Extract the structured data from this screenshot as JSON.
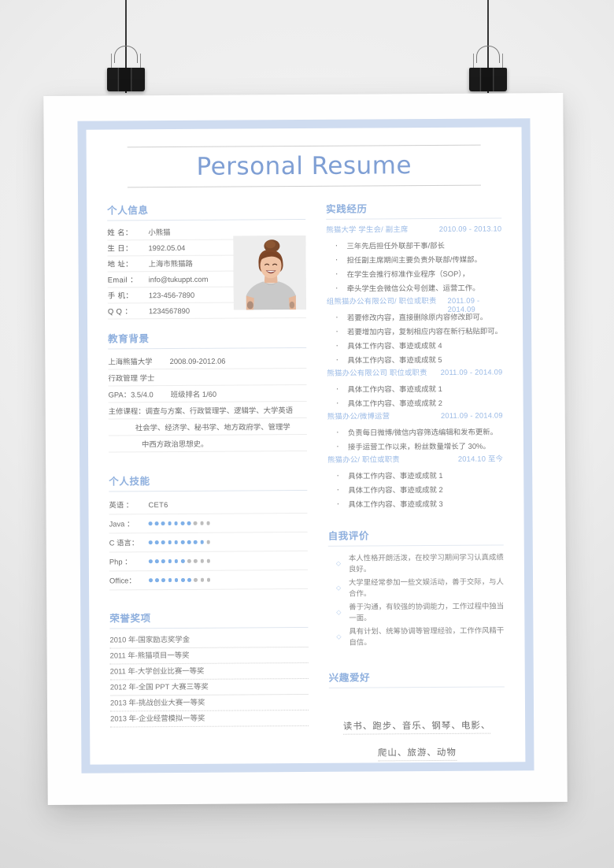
{
  "document": {
    "title": "Personal Resume"
  },
  "left": {
    "personal_info": {
      "heading": "个人信息",
      "rows": [
        {
          "key": "姓  名：",
          "value": "小熊猫"
        },
        {
          "key": "生  日：",
          "value": "1992.05.04"
        },
        {
          "key": "地  址：",
          "value": "上海市熊猫路"
        },
        {
          "key": "Email ：",
          "value": "info@tukuppt.com"
        },
        {
          "key": "手  机：",
          "value": "123-456-7890"
        },
        {
          "key": "Q  Q ：",
          "value": "1234567890"
        }
      ],
      "photo_alt": "portrait-photo"
    },
    "education": {
      "heading": "教育背景",
      "rows": [
        {
          "text": "上海熊猫大学",
          "extra": "2008.09-2012.06",
          "indent": 0
        },
        {
          "text": "行政管理 学士",
          "extra": "",
          "indent": 0
        },
        {
          "text": "GPA：3.5/4.0",
          "extra": "班级排名 1/60",
          "indent": 0
        },
        {
          "text": "主修课程：调查与方案、行政管理学、逻辑学、大学英语",
          "extra": "",
          "indent": 0
        },
        {
          "text": "社会学、经济学、秘书学、地方政府学、管理学",
          "extra": "",
          "indent": 1
        },
        {
          "text": "中西方政治思想史。",
          "extra": "",
          "indent": 2
        }
      ]
    },
    "skills": {
      "heading": "个人技能",
      "rows": [
        {
          "key": "英语  ：",
          "value": "CET6",
          "filled": null,
          "total": null
        },
        {
          "key": "Java  ：",
          "value": "",
          "filled": 7,
          "total": 10
        },
        {
          "key": "C 语言：",
          "value": "",
          "filled": 9,
          "total": 10
        },
        {
          "key": "Php   ：",
          "value": "",
          "filled": 6,
          "total": 10
        },
        {
          "key": "Office：",
          "value": "",
          "filled": 7,
          "total": 10
        }
      ]
    },
    "awards": {
      "heading": "荣誉奖项",
      "rows": [
        "2010 年-国家励志奖学金",
        "2011 年-熊猫项目一等奖",
        "2011 年-大学创业比赛一等奖",
        "2012 年-全国 PPT 大赛三等奖",
        "2013 年-挑战创业大赛一等奖",
        "2013 年-企业经营模拟一等奖"
      ]
    }
  },
  "right": {
    "experience": {
      "heading": "实践经历",
      "jobs": [
        {
          "title": "熊猫大学 学生会/ 副主席",
          "date": "2010.09 - 2013.10",
          "bullets": [
            "三年先后担任外联部干事/部长",
            "担任副主席期间主要负责外联部/传媒部。",
            "在学生会推行标准作业程序（SOP），",
            "牵头学生会微信公众号创建、运营工作。"
          ]
        },
        {
          "title": "组熊猫办公有限公司/ 职位或职责",
          "date": "2011.09 - 2014.09",
          "bullets": [
            "若要修改内容，直接删除原内容修改即可。",
            "若要增加内容，复制相应内容在新行粘贴即可。",
            "具体工作内容、事迹或成就 4",
            "具体工作内容、事迹或成就 5"
          ]
        },
        {
          "title": "熊猫办公有限公司 职位或职责",
          "date": "2011.09 - 2014.09",
          "bullets": [
            "具体工作内容、事迹或成就 1",
            "具体工作内容、事迹或成就 2"
          ]
        },
        {
          "title": "熊猫办公/微博运营",
          "date": "2011.09 - 2014.09",
          "bullets": [
            "负责每日微博/微信内容筛选编辑和发布更新。",
            "接手运营工作以来，粉丝数量增长了 30%。"
          ]
        },
        {
          "title": "熊猫办公/ 职位或职责",
          "date": "2014.10 至今",
          "bullets": [
            "具体工作内容、事迹或成就 1",
            "具体工作内容、事迹或成就 2",
            "具体工作内容、事迹或成就 3"
          ]
        }
      ]
    },
    "self_evaluation": {
      "heading": "自我评价",
      "items": [
        "本人性格开朗活泼，在校学习期间学习认真成绩良好。",
        "大学里经常参加一些文娱活动，善于交际，与人合作。",
        "善于沟通，有较强的协调能力，工作过程中独当一面。",
        "具有计划、统筹协调等管理经验，工作作风精干自信。"
      ]
    },
    "hobbies": {
      "heading": "兴趣爱好",
      "lines": [
        "读书、跑步、音乐、钢琴、电影、",
        "爬山、旅游、动物"
      ]
    }
  },
  "decor": {
    "clip_left_name": "binder-clip-left",
    "clip_right_name": "binder-clip-right",
    "bullet_glyph": "·",
    "diamond_glyph": "◇"
  },
  "colors": {
    "title_blue": "#7f9fd4",
    "heading_blue": "#8fb0de",
    "job_blue": "#9cbbe6",
    "frame_blue": "#cfdcf0",
    "dot_on": "#7fb0e8",
    "dot_off": "#bdbdbd",
    "body_gray": "#6d6d6d"
  }
}
